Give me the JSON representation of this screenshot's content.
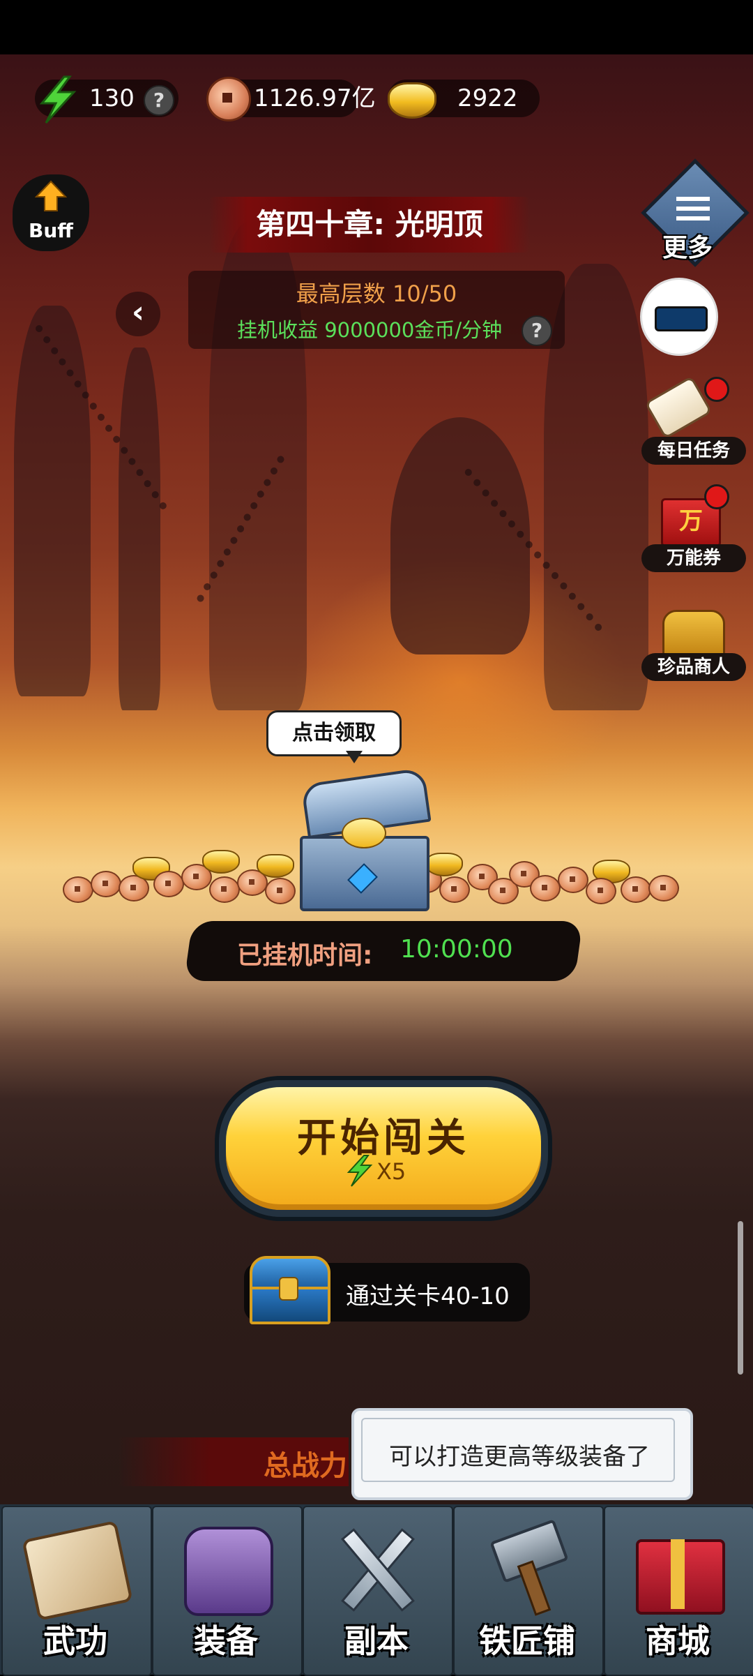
{
  "resources": {
    "energy": "130",
    "copper": "1126.97亿",
    "gold": "2922"
  },
  "buff_label": "Buff",
  "more_label": "更多",
  "chapter": {
    "title": "第四十章: 光明顶",
    "floor": "最高层数 10/50",
    "income": "挂机收益 9000000金币/分钟"
  },
  "side_buttons": {
    "daily": "每日任务",
    "voucher": "万能券",
    "voucher_glyph": "万",
    "merchant": "珍品商人"
  },
  "reward": {
    "bubble": "点击领取",
    "afk_label": "已挂机时间:",
    "afk_time": "10:00:00"
  },
  "start": {
    "label": "开始闯关",
    "cost": "X5"
  },
  "goal": "通过关卡40-10",
  "power_label": "总战力",
  "tooltip": "可以打造更高等级装备了",
  "nav": [
    "武功",
    "装备",
    "副本",
    "铁匠铺",
    "商城"
  ],
  "colors": {
    "income_green": "#5be05b",
    "floor_orange": "#f0a04a",
    "button_gold": "#ffd23a"
  }
}
